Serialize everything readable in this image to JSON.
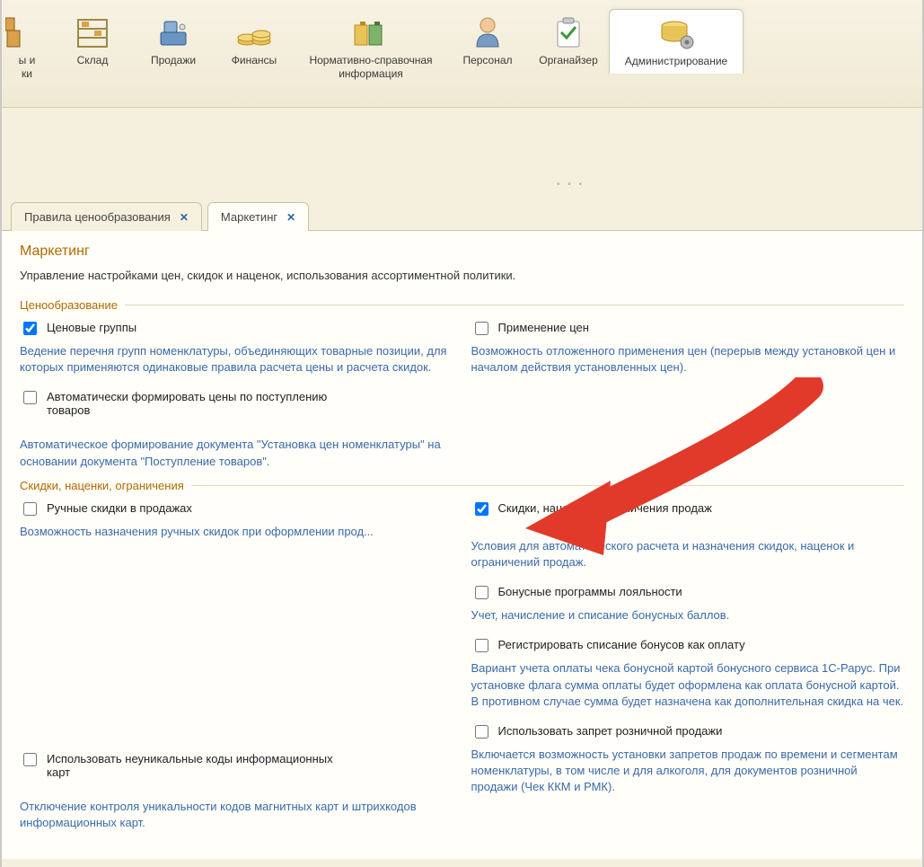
{
  "toolbar": {
    "items": [
      {
        "label_line1": "ы и",
        "label_line2": "ки"
      },
      {
        "label_line1": "Склад",
        "label_line2": ""
      },
      {
        "label_line1": "Продажи",
        "label_line2": ""
      },
      {
        "label_line1": "Финансы",
        "label_line2": ""
      },
      {
        "label_line1": "Нормативно-справочная",
        "label_line2": "информация"
      },
      {
        "label_line1": "Персонал",
        "label_line2": ""
      },
      {
        "label_line1": "Органайзер",
        "label_line2": ""
      },
      {
        "label_line1": "Администрирование",
        "label_line2": ""
      }
    ]
  },
  "tabs": [
    {
      "label": "Правила ценообразования"
    },
    {
      "label": "Маркетинг"
    }
  ],
  "page": {
    "title": "Маркетинг",
    "subtitle": "Управление настройками цен, скидок и наценок, использования ассортиментной политики."
  },
  "group1": {
    "title": "Ценообразование",
    "left": {
      "opt1_label": "Ценовые группы",
      "opt1_desc": "Ведение перечня групп номенклатуры, объединяющих товарные позиции, для которых применяются одинаковые правила расчета цены и расчета скидок.",
      "opt2_label": "Автоматически формировать цены по поступлению товаров",
      "opt2_desc": "Автоматическое формирование документа \"Установка цен номенклатуры\" на основании документа \"Поступление товаров\"."
    },
    "right": {
      "opt1_label": "Применение цен",
      "opt1_desc": "Возможность отложенного применения цен (перерыв между установкой цен и началом действия установленных цен)."
    }
  },
  "group2": {
    "title": "Скидки, наценки, ограничения",
    "left": {
      "opt1_label": "Ручные скидки в продажах",
      "opt1_desc": "Возможность назначения ручных скидок при оформлении прод...",
      "opt2_label": "Использовать неуникальные коды информационных карт",
      "opt2_desc": "Отключение контроля уникальности кодов магнитных карт и штрихкодов информационных карт."
    },
    "right": {
      "opt1_label": "Скидки, наценки и ограничения продаж",
      "opt1_desc": "Условия для автоматического расчета и назначения скидок, наценок и ограничений продаж.",
      "opt2_label": "Бонусные программы лояльности",
      "opt2_desc": "Учет, начисление и списание бонусных баллов.",
      "opt3_label": "Регистрировать списание бонусов как оплату",
      "opt3_desc": "Вариант учета оплаты чека бонусной картой бонусного сервиса 1С-Рарус. При установке флага сумма оплаты будет оформлена как оплата бонусной картой. В противном случае сумма будет назначена как дополнительная скидка на чек.",
      "opt4_label": "Использовать запрет розничной продажи",
      "opt4_desc": "Включается возможность установки запретов продаж по времени и сегментам номенклатуры, в том числе и для алкоголя, для документов розничной продажи (Чек ККМ и РМК)."
    }
  }
}
